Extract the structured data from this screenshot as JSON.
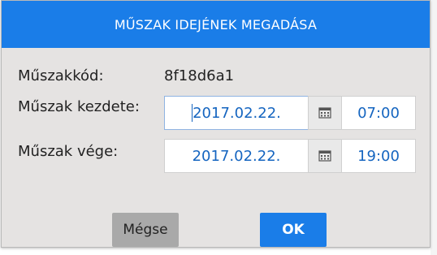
{
  "dialog": {
    "title": "MŰSZAK IDEJÉNEK MEGADÁSA",
    "shift_code_label": "Műszakkód:",
    "shift_code_value": "8f18d6a1",
    "start": {
      "label": "Műszak kezdete:",
      "date": "2017.02.22.",
      "time": "07:00"
    },
    "end": {
      "label": "Műszak vége:",
      "date": "2017.02.22.",
      "time": "19:00"
    },
    "cancel_label": "Mégse",
    "ok_label": "OK"
  },
  "colors": {
    "header": "#1a7de8",
    "ok_button": "#1a7de8",
    "cancel_button": "#a9a9a9",
    "panel": "#e5e3e2",
    "value_text": "#1565c0"
  },
  "icons": {
    "calendar": "calendar-icon"
  }
}
